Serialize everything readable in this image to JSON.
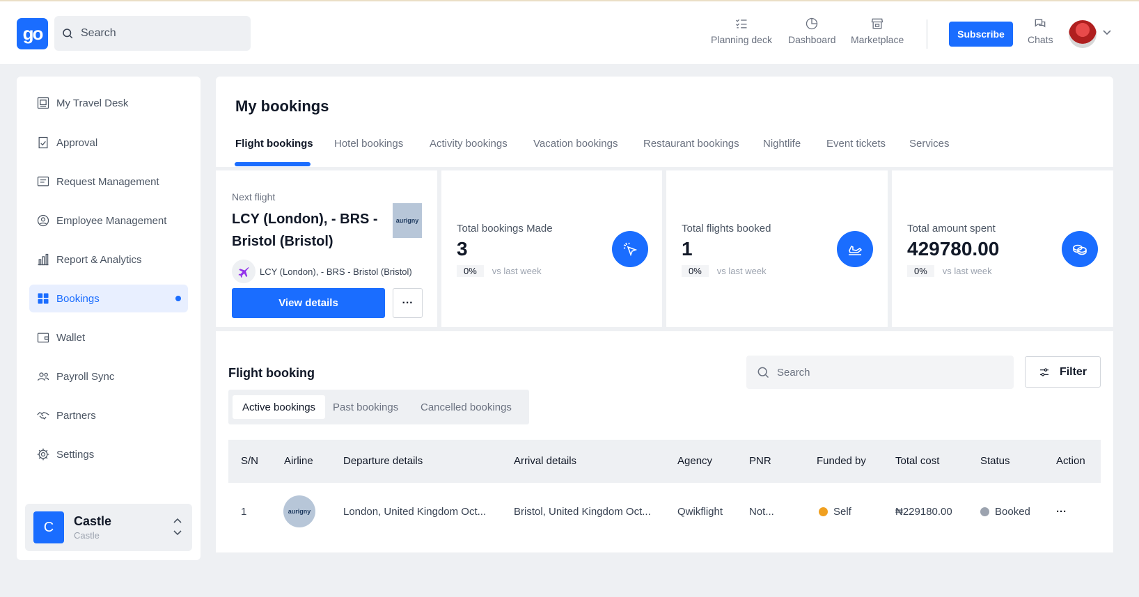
{
  "header": {
    "logo_text": "go",
    "search_placeholder": "Search",
    "nav": [
      {
        "label": "Planning deck",
        "icon": "checklist-icon"
      },
      {
        "label": "Dashboard",
        "icon": "pie-chart-icon"
      },
      {
        "label": "Marketplace",
        "icon": "store-icon"
      }
    ],
    "subscribe_label": "Subscribe",
    "chats_label": "Chats"
  },
  "sidebar": {
    "items": [
      {
        "label": "My Travel Desk",
        "icon": "travel-desk-icon"
      },
      {
        "label": "Approval",
        "icon": "approval-icon"
      },
      {
        "label": "Request Management",
        "icon": "request-icon"
      },
      {
        "label": "Employee Management",
        "icon": "employee-icon"
      },
      {
        "label": "Report & Analytics",
        "icon": "bar-chart-icon"
      },
      {
        "label": "Bookings",
        "icon": "grid-icon",
        "active": true
      },
      {
        "label": "Wallet",
        "icon": "wallet-icon"
      },
      {
        "label": "Payroll Sync",
        "icon": "users-icon"
      },
      {
        "label": "Partners",
        "icon": "handshake-icon"
      },
      {
        "label": "Settings",
        "icon": "gear-icon"
      }
    ],
    "user": {
      "initial": "C",
      "name": "Castle",
      "sub": "Castle"
    }
  },
  "main": {
    "title": "My bookings",
    "tabs": [
      "Flight bookings",
      "Hotel bookings",
      "Activity bookings",
      "Vacation bookings",
      "Restaurant bookings",
      "Nightlife",
      "Event tickets",
      "Services"
    ],
    "next_flight": {
      "label": "Next flight",
      "title": "LCY (London), - BRS - Bristol (Bristol)",
      "airline": "aurigny",
      "route": "LCY (London), - BRS - Bristol (Bristol)",
      "view_label": "View details",
      "more_label": "···"
    },
    "stats": [
      {
        "label": "Total bookings Made",
        "value": "3",
        "change": "0%",
        "vs": "vs last week",
        "icon": "cursor-click-icon"
      },
      {
        "label": "Total flights booked",
        "value": "1",
        "change": "0%",
        "vs": "vs last week",
        "icon": "plane-landing-icon"
      },
      {
        "label": "Total amount spent",
        "value": "429780.00",
        "change": "0%",
        "vs": "vs last week",
        "icon": "coins-icon"
      }
    ]
  },
  "flight_booking": {
    "title": "Flight booking",
    "subtabs": [
      "Active bookings",
      "Past bookings",
      "Cancelled bookings"
    ],
    "search_placeholder": "Search",
    "filter_label": "Filter",
    "columns": [
      "S/N",
      "Airline",
      "Departure details",
      "Arrival details",
      "Agency",
      "PNR",
      "Funded by",
      "Total cost",
      "Status",
      "Action"
    ],
    "rows": [
      {
        "sn": "1",
        "airline": "aurigny",
        "departure": "London, United Kingdom Oct...",
        "arrival": "Bristol, United Kingdom Oct...",
        "agency": "Qwikflight",
        "pnr": "Not...",
        "funded_by": "Self",
        "total_cost": "₦229180.00",
        "status": "Booked",
        "action": "···"
      }
    ],
    "colors": {
      "funded_dot": "#f0a020",
      "status_dot": "#9ca3af"
    }
  }
}
